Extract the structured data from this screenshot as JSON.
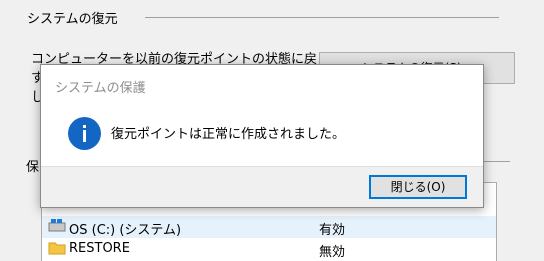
{
  "background": {
    "section_title": "システムの復元",
    "restore_description": "コンピューターを以前の復元ポイントの状態に戻\nす\nし",
    "restore_button_label": "システムの復元(S)...",
    "protection_label": "保",
    "drives": [
      {
        "name": "OS (C:) (システム)",
        "status": "有効",
        "selected": true
      },
      {
        "name": "RESTORE",
        "status": "無効",
        "selected": false
      }
    ]
  },
  "dialog": {
    "title": "システムの保護",
    "message": "復元ポイントは正常に作成されました。",
    "icon": "info-icon",
    "close_button_label": "閉じる(O)"
  },
  "colors": {
    "info_icon": "#1366c4",
    "focus_border": "#0078d7",
    "selected_row": "#e5f1fb"
  }
}
